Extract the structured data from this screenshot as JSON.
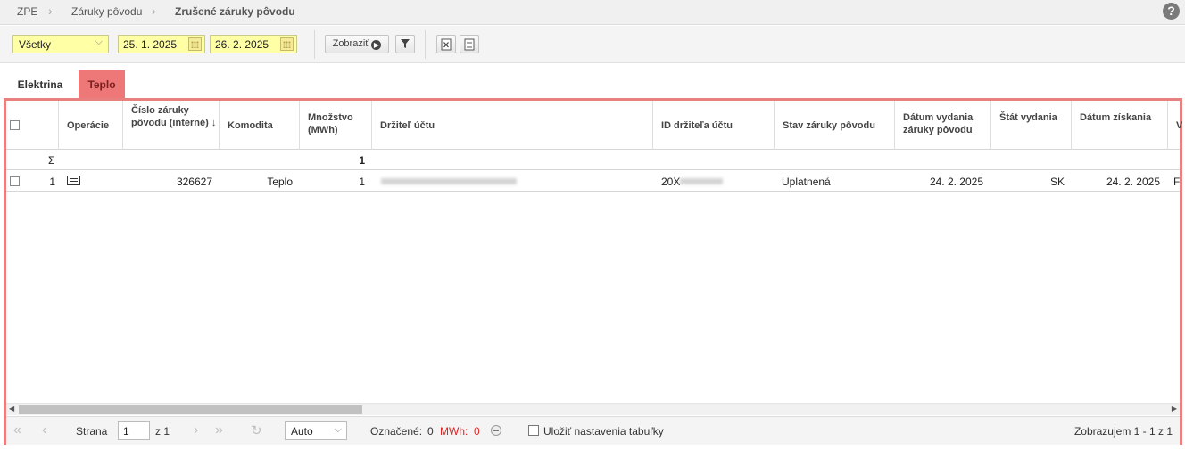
{
  "breadcrumb": {
    "items": [
      "ZPE",
      "Záruky pôvodu",
      "Zrušené záruky pôvodu"
    ],
    "help_icon": "question-mark-icon"
  },
  "toolbar": {
    "filter_value": "Všetky",
    "date_from": "25. 1. 2025",
    "date_to": "26. 2. 2025",
    "show_label": "Zobraziť",
    "icons": [
      "calendar-icon",
      "filter-icon",
      "excel-export-icon",
      "document-export-icon"
    ]
  },
  "tabs": [
    {
      "label": "Elektrina",
      "active": false
    },
    {
      "label": "Teplo",
      "active": true
    }
  ],
  "colors": {
    "accent": "#ee7777",
    "frame": "#e88080",
    "input_bg": "#ffffa6",
    "negative": "#e02020"
  },
  "grid": {
    "columns": [
      "",
      "Operácie",
      "Číslo záruky pôvodu (interné) ↓",
      "Komodita",
      "Množstvo (MWh)",
      "Držiteľ účtu",
      "ID držiteľa účtu",
      "Stav záruky pôvodu",
      "Dátum vydania záruky pôvodu",
      "Štát vydania",
      "Dátum získania",
      "V"
    ],
    "sum_row": {
      "symbol": "Σ",
      "quantity": "1"
    },
    "rows": [
      {
        "index": "1",
        "number": "326627",
        "commodity": "Teplo",
        "quantity": "1",
        "holder_id": "20X",
        "status": "Uplatnená",
        "issue_date": "24. 2. 2025",
        "country": "SK",
        "obtained_date": "24. 2. 2025",
        "extra": "F"
      }
    ]
  },
  "pager": {
    "page_label": "Strana",
    "page_value": "1",
    "of_label": "z 1",
    "page_size": "Auto",
    "selected_label": "Označené:",
    "selected_count": "0",
    "mwh_label": "MWh:",
    "mwh_value": "0",
    "save_label": "Uložiť nastavenia tabuľky",
    "status": "Zobrazujem 1 - 1 z 1"
  }
}
